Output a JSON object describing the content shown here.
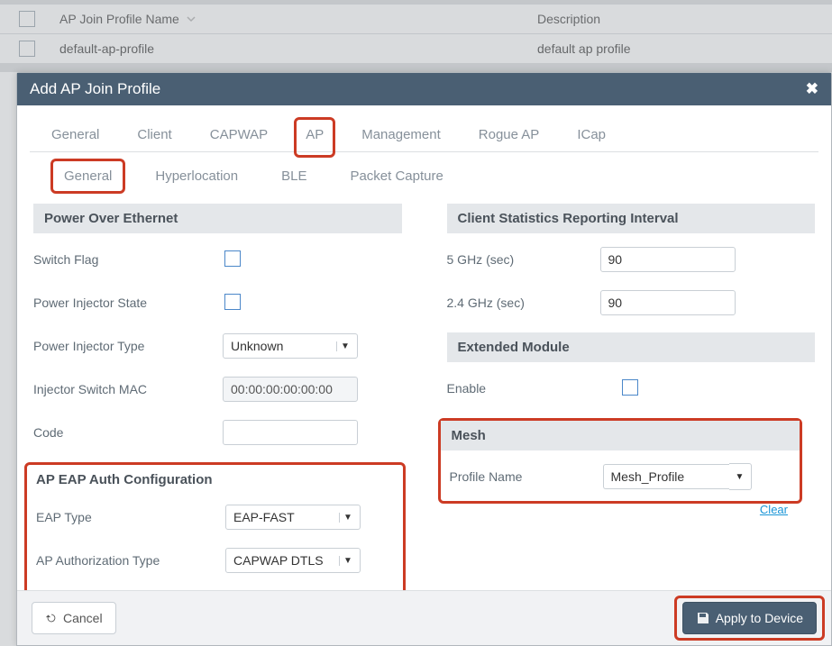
{
  "table": {
    "head_name": "AP Join Profile Name",
    "head_desc": "Description",
    "row_name": "default-ap-profile",
    "row_desc": "default ap profile"
  },
  "modal": {
    "title": "Add AP Join Profile",
    "tabs": [
      "General",
      "Client",
      "CAPWAP",
      "AP",
      "Management",
      "Rogue AP",
      "ICap"
    ],
    "active_tab": "AP",
    "subtabs": [
      "General",
      "Hyperlocation",
      "BLE",
      "Packet Capture"
    ],
    "active_subtab": "General"
  },
  "poe": {
    "section": "Power Over Ethernet",
    "switch_flag_label": "Switch Flag",
    "power_injector_state_label": "Power Injector State",
    "power_injector_type_label": "Power Injector Type",
    "power_injector_type_value": "Unknown",
    "injector_switch_mac_label": "Injector Switch MAC",
    "injector_switch_mac_value": "00:00:00:00:00:00",
    "code_label": "Code",
    "code_value": ""
  },
  "eap": {
    "section": "AP EAP Auth Configuration",
    "eap_type_label": "EAP Type",
    "eap_type_value": "EAP-FAST",
    "auth_type_label": "AP Authorization Type",
    "auth_type_value": "CAPWAP DTLS"
  },
  "stats": {
    "section": "Client Statistics Reporting Interval",
    "five_label": "5 GHz (sec)",
    "five_value": "90",
    "twofour_label": "2.4 GHz (sec)",
    "twofour_value": "90"
  },
  "ext": {
    "section": "Extended Module",
    "enable_label": "Enable"
  },
  "mesh": {
    "section": "Mesh",
    "profile_label": "Profile Name",
    "profile_value": "Mesh_Profile",
    "clear_label": "Clear"
  },
  "footer": {
    "cancel": "Cancel",
    "apply": "Apply to Device"
  }
}
